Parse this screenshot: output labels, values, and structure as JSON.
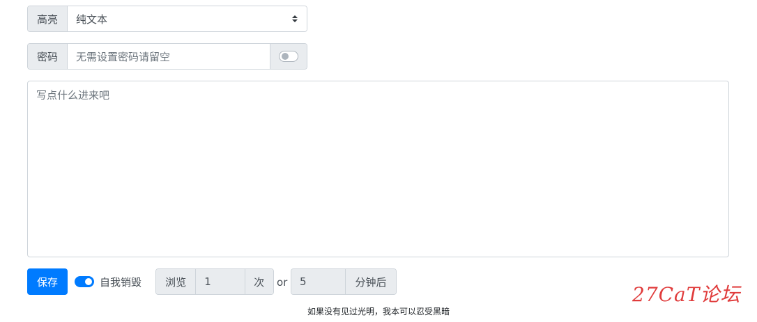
{
  "highlight": {
    "label": "高亮",
    "selected": "纯文本"
  },
  "password": {
    "label": "密码",
    "placeholder": "无需设置密码请留空",
    "toggle_on": false
  },
  "content": {
    "placeholder": "写点什么进来吧"
  },
  "actions": {
    "save_label": "保存",
    "self_destruct_label": "自我销毁",
    "self_destruct_on": true,
    "views_prefix": "浏览",
    "views_value": "1",
    "views_suffix": "次",
    "or_label": "or",
    "minutes_value": "5",
    "minutes_suffix": "分钟后"
  },
  "footer": {
    "quote": "如果没有见过光明，我本可以忍受黑暗"
  },
  "watermark": {
    "text": "27CaT论坛"
  },
  "colors": {
    "primary": "#007bff",
    "addon_bg": "#e9ecef",
    "border": "#ced4da",
    "watermark": "#e03c3c"
  }
}
